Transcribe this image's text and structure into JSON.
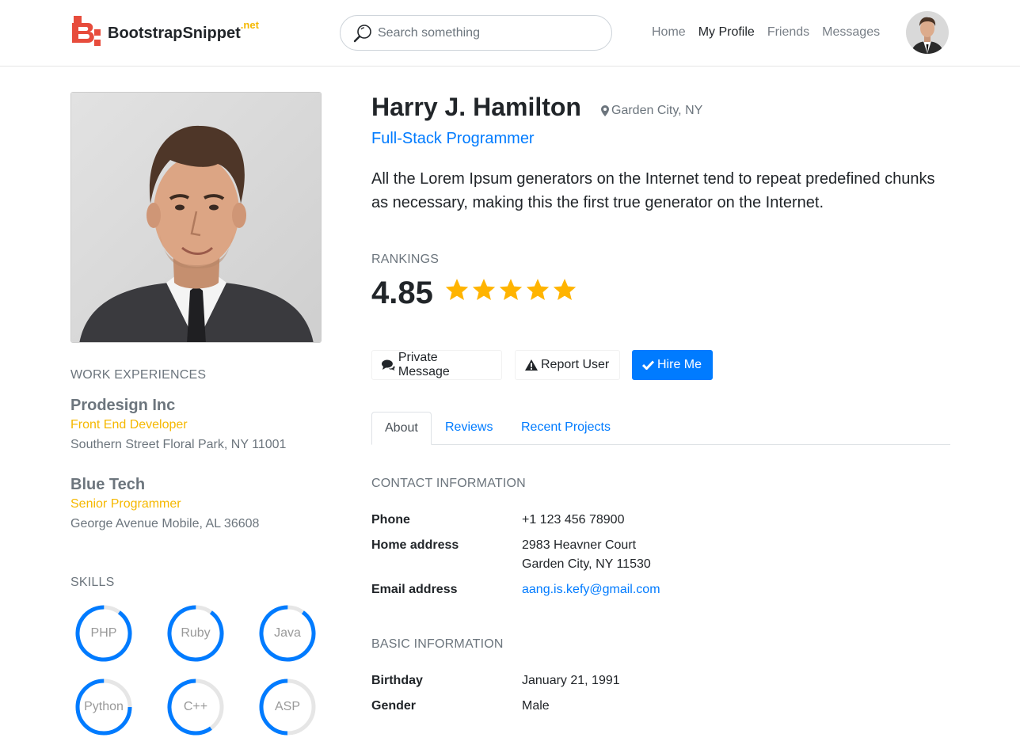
{
  "header": {
    "brand_name": "BootstrapSnippet",
    "brand_tld": ".net",
    "search_placeholder": "Search something",
    "nav": [
      {
        "label": "Home",
        "active": false
      },
      {
        "label": "My Profile",
        "active": true
      },
      {
        "label": "Friends",
        "active": false
      },
      {
        "label": "Messages",
        "active": false
      }
    ]
  },
  "work": {
    "title": "WORK EXPERIENCES",
    "jobs": [
      {
        "company": "Prodesign Inc",
        "role": "Front End Developer",
        "address": "Southern Street Floral Park, NY 11001"
      },
      {
        "company": "Blue Tech",
        "role": "Senior Programmer",
        "address": "George Avenue Mobile, AL 36608"
      }
    ]
  },
  "skills": {
    "title": "SKILLS",
    "items": [
      {
        "name": "PHP",
        "level": 0.9
      },
      {
        "name": "Ruby",
        "level": 0.9
      },
      {
        "name": "Java",
        "level": 0.9
      },
      {
        "name": "Python",
        "level": 0.75
      },
      {
        "name": "C++",
        "level": 0.6
      },
      {
        "name": "ASP",
        "level": 0.5
      }
    ]
  },
  "profile": {
    "name": "Harry J. Hamilton",
    "location": "Garden City, NY",
    "title": "Full-Stack Programmer",
    "bio": "All the Lorem Ipsum generators on the Internet tend to repeat predefined chunks as necessary, making this the first true generator on the Internet.",
    "rankings_label": "RANKINGS",
    "rating": "4.85",
    "stars": 5
  },
  "actions": {
    "private_message": "Private Message",
    "report_user": "Report User",
    "hire_me": "Hire Me"
  },
  "tabs": [
    {
      "label": "About",
      "active": true
    },
    {
      "label": "Reviews",
      "active": false
    },
    {
      "label": "Recent Projects",
      "active": false
    }
  ],
  "contact": {
    "title": "CONTACT INFORMATION",
    "phone_label": "Phone",
    "phone": "+1 123 456 78900",
    "address_label": "Home address",
    "address_line1": "2983 Heavner Court",
    "address_line2": "Garden City, NY 11530",
    "email_label": "Email address",
    "email": "aang.is.kefy@gmail.com"
  },
  "basic": {
    "title": "BASIC INFORMATION",
    "birthday_label": "Birthday",
    "birthday": "January 21, 1991",
    "gender_label": "Gender",
    "gender": "Male"
  },
  "colors": {
    "accent": "#007bff",
    "gold": "#f5b800",
    "star": "#ffb400",
    "logo": "#e74c3c"
  }
}
